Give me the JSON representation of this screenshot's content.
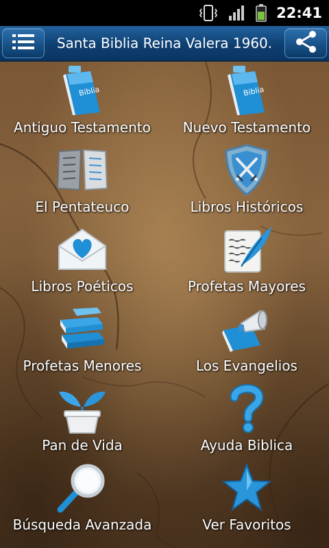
{
  "status_bar": {
    "time": "22:41",
    "icons": [
      "vibrate-icon",
      "signal-icon",
      "battery-icon"
    ]
  },
  "header": {
    "title": "Santa Biblia Reina Valera 1960.",
    "menu_icon": "list-menu-icon",
    "share_icon": "share-icon"
  },
  "colors": {
    "header_top": "#22629e",
    "header_bottom": "#0a3563",
    "label_text": "#ffffff"
  },
  "menu": {
    "items": [
      {
        "label": "Antiguo Testamento",
        "icon": "bible-book-icon"
      },
      {
        "label": "Nuevo Testamento",
        "icon": "bible-book-icon"
      },
      {
        "label": "El Pentateuco",
        "icon": "scroll-tablets-icon"
      },
      {
        "label": "Libros Históricos",
        "icon": "shield-swords-icon"
      },
      {
        "label": "Libros Poéticos",
        "icon": "heart-envelope-icon"
      },
      {
        "label": "Profetas Mayores",
        "icon": "quill-paper-icon"
      },
      {
        "label": "Profetas Menores",
        "icon": "book-stack-icon"
      },
      {
        "label": "Los Evangelios",
        "icon": "book-megaphone-icon"
      },
      {
        "label": "Pan de Vida",
        "icon": "sprout-pot-icon"
      },
      {
        "label": "Ayuda Biblica",
        "icon": "question-mark-icon"
      },
      {
        "label": "Búsqueda Avanzada",
        "icon": "magnifier-icon"
      },
      {
        "label": "Ver Favoritos",
        "icon": "star-icon"
      }
    ]
  }
}
